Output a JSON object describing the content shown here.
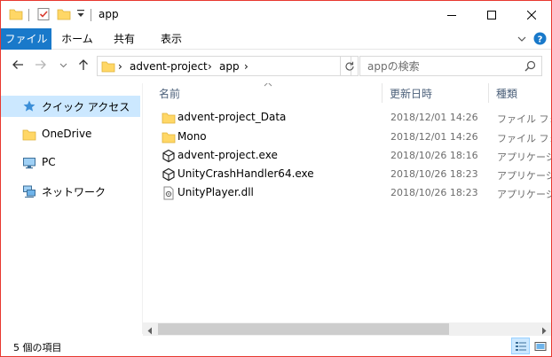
{
  "window": {
    "title": "app",
    "controls": {
      "minimize": "─",
      "maximize": "☐",
      "close": "✕"
    }
  },
  "ribbon": {
    "tabs": [
      {
        "label": "ファイル",
        "active": true
      },
      {
        "label": "ホーム"
      },
      {
        "label": "共有"
      },
      {
        "label": "表示"
      }
    ],
    "collapse_icon": "chevron-down-icon",
    "help_icon": "help-icon",
    "accent": "#1979ca"
  },
  "nav": {
    "breadcrumb": [
      "advent-project",
      "app"
    ],
    "search_placeholder": "appの検索"
  },
  "sidebar": {
    "items": [
      {
        "label": "クイック アクセス",
        "icon": "star-icon",
        "selected": true
      },
      {
        "label": "OneDrive",
        "icon": "folder-icon"
      },
      {
        "label": "PC",
        "icon": "pc-icon"
      },
      {
        "label": "ネットワーク",
        "icon": "network-icon"
      }
    ]
  },
  "columns": {
    "name": "名前",
    "date": "更新日時",
    "type": "種類"
  },
  "files": [
    {
      "name": "advent-project_Data",
      "date": "2018/12/01 14:26",
      "type": "ファイル フォル",
      "icon": "folder-icon"
    },
    {
      "name": "Mono",
      "date": "2018/12/01 14:26",
      "type": "ファイル フォル",
      "icon": "folder-icon"
    },
    {
      "name": "advent-project.exe",
      "date": "2018/10/26 18:16",
      "type": "アプリケーション",
      "icon": "unity-icon"
    },
    {
      "name": "UnityCrashHandler64.exe",
      "date": "2018/10/26 18:23",
      "type": "アプリケーション",
      "icon": "unity-icon"
    },
    {
      "name": "UnityPlayer.dll",
      "date": "2018/10/26 18:23",
      "type": "アプリケーション",
      "icon": "dll-icon"
    }
  ],
  "status": {
    "item_count": "5 個の項目"
  }
}
